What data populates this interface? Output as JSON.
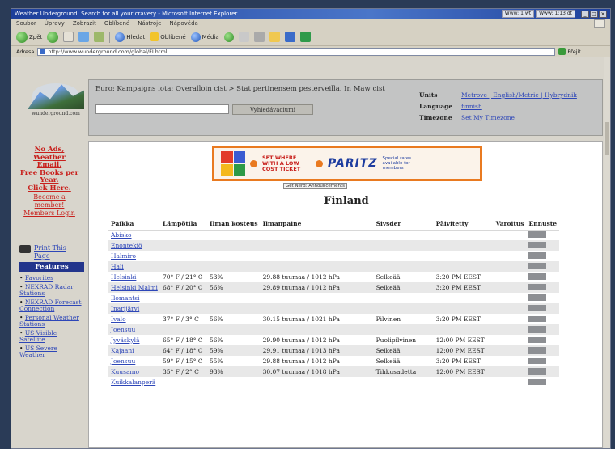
{
  "window": {
    "title": "Weather Underground: Search for all your cravery - Microsoft Internet Explorer",
    "tray": [
      "Www: 1 wt",
      "Www: 1:13 dt"
    ],
    "menu": [
      "Soubor",
      "Úpravy",
      "Zobrazit",
      "Oblíbené",
      "Nástroje",
      "Nápověda"
    ]
  },
  "toolbar": {
    "back": "Zpět",
    "search": "Hledat",
    "favorites": "Oblíbené",
    "media": "Média"
  },
  "address": {
    "label": "Adresa",
    "url": "http://www.wunderground.com/global/FI.html",
    "go": "Přejít"
  },
  "site": {
    "logo_text": "wunderground.com"
  },
  "header": {
    "breadcrumb": "Euro: Kampaigns iota: Overalloin cist > Stat pertinensem pesterveilla. In Maw cist",
    "search_button": "Vyhledávaciumi",
    "prefs": [
      {
        "key": "Units",
        "value": "Metrove | English/Metric | Hybrydnik"
      },
      {
        "key": "Language",
        "value": "finnish"
      },
      {
        "key": "Timezone",
        "value": "Set My Timezone"
      }
    ]
  },
  "leftnav": {
    "promo": [
      "No Ads,",
      "Weather",
      "Email,",
      "Free Books per",
      "Year.",
      "Click Here."
    ],
    "promo2": [
      "Become a",
      "member!",
      "Members Login"
    ],
    "print": "Print This Page",
    "features_title": "Features",
    "features": [
      "Favorites",
      "NEXRAD Radar Stations",
      "NEXRAD Forecast Connection",
      "Personal Weather Stations",
      "US Visible Satellite",
      "US Severe Weather"
    ]
  },
  "ad": {
    "red_text": "SET WHERE WITH A LOW COST TICKET",
    "brand": "PARITZ",
    "small_text": "Special rates available for members",
    "caption": "Get Nerd: Announcements"
  },
  "main": {
    "title": "Finland"
  },
  "table": {
    "headers": [
      "Paikka",
      "Lämpötila",
      "Ilman kosteus",
      "Ilmanpaine",
      "Sivsder",
      "Päivitetty",
      "Varoitus",
      "Ennuste"
    ],
    "rows": [
      {
        "place": "Abisko",
        "temp": "",
        "hum": "",
        "pres": "",
        "cond": "",
        "upd": "",
        "warn": ""
      },
      {
        "place": "Enontekiö",
        "temp": "",
        "hum": "",
        "pres": "",
        "cond": "",
        "upd": "",
        "warn": ""
      },
      {
        "place": "Halmiro",
        "temp": "",
        "hum": "",
        "pres": "",
        "cond": "",
        "upd": "",
        "warn": ""
      },
      {
        "place": "Hali",
        "temp": "",
        "hum": "",
        "pres": "",
        "cond": "",
        "upd": "",
        "warn": ""
      },
      {
        "place": "Helsinki",
        "temp": "70° F / 21° C",
        "hum": "53%",
        "pres": "29.88 tuumaa / 1012 hPa",
        "cond": "Selkeää",
        "upd": "3:20 PM EEST",
        "warn": ""
      },
      {
        "place": "Helsinki Malmi",
        "temp": "68° F / 20° C",
        "hum": "56%",
        "pres": "29.89 tuumaa / 1012 hPa",
        "cond": "Selkeää",
        "upd": "3:20 PM EEST",
        "warn": ""
      },
      {
        "place": "Ilomantsi",
        "temp": "",
        "hum": "",
        "pres": "",
        "cond": "",
        "upd": "",
        "warn": ""
      },
      {
        "place": "Inarijärvi",
        "temp": "",
        "hum": "",
        "pres": "",
        "cond": "",
        "upd": "",
        "warn": ""
      },
      {
        "place": "Ivalo",
        "temp": "37° F / 3° C",
        "hum": "56%",
        "pres": "30.15 tuumaa / 1021 hPa",
        "cond": "Pilvinen",
        "upd": "3:20 PM EEST",
        "warn": ""
      },
      {
        "place": "Joensuu",
        "temp": "",
        "hum": "",
        "pres": "",
        "cond": "",
        "upd": "",
        "warn": ""
      },
      {
        "place": "Jyväskylä",
        "temp": "65° F / 18° C",
        "hum": "56%",
        "pres": "29.90 tuumaa / 1012 hPa",
        "cond": "Puolipilvinen",
        "upd": "12:00 PM EEST",
        "warn": ""
      },
      {
        "place": "Kajaani",
        "temp": "64° F / 18° C",
        "hum": "59%",
        "pres": "29.91 tuumaa / 1013 hPa",
        "cond": "Selkeää",
        "upd": "12:00 PM EEST",
        "warn": ""
      },
      {
        "place": "Joensuu",
        "temp": "59° F / 15° C",
        "hum": "55%",
        "pres": "29.88 tuumaa / 1012 hPa",
        "cond": "Selkeää",
        "upd": "3:20 PM EEST",
        "warn": ""
      },
      {
        "place": "Kuusamo",
        "temp": "35° F / 2° C",
        "hum": "93%",
        "pres": "30.07 tuumaa / 1018 hPa",
        "cond": "Tihkusadetta",
        "upd": "12:00 PM EEST",
        "warn": ""
      },
      {
        "place": "Kuikkalanperä",
        "temp": "",
        "hum": "",
        "pres": "",
        "cond": "",
        "upd": "",
        "warn": ""
      }
    ]
  }
}
